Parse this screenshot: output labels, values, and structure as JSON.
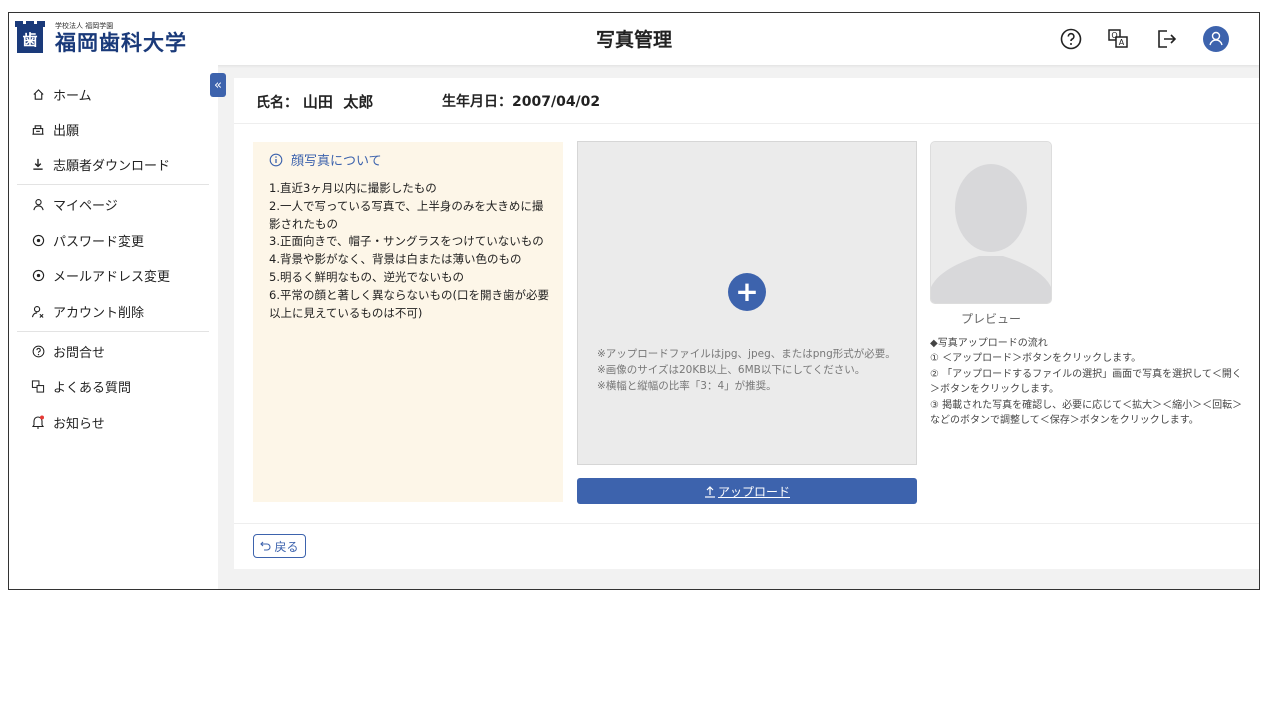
{
  "header": {
    "logo_sub": "学校法人 福岡学園",
    "logo_main": "福岡歯科大学",
    "title": "写真管理",
    "icons": [
      "help-icon",
      "faq-icon",
      "logout-icon",
      "user-avatar-icon"
    ]
  },
  "sidebar": {
    "items": [
      {
        "label": "ホーム",
        "icon": "home-icon"
      },
      {
        "label": "出願",
        "icon": "apply-icon"
      },
      {
        "label": "志願者ダウンロード",
        "icon": "download-icon"
      },
      {
        "label": "マイページ",
        "icon": "user-icon"
      },
      {
        "label": "パスワード変更",
        "icon": "password-icon"
      },
      {
        "label": "メールアドレス変更",
        "icon": "mail-icon"
      },
      {
        "label": "アカウント削除",
        "icon": "user-remove-icon"
      },
      {
        "label": "お問合せ",
        "icon": "question-icon"
      },
      {
        "label": "よくある質問",
        "icon": "faq-icon"
      },
      {
        "label": "お知らせ",
        "icon": "bell-icon"
      }
    ],
    "collapse_glyph": "«"
  },
  "student": {
    "name_label": "氏名：",
    "name": "山田  太郎",
    "dob_label": "生年月日：",
    "dob": "2007/04/02"
  },
  "notes": {
    "title": "顔写真について",
    "items": [
      "1.直近3ヶ月以内に撮影したもの",
      "2.一人で写っている写真で、上半身のみを大きめに撮影されたもの",
      "3.正面向きで、帽子・サングラスをつけていないもの",
      "4.背景や影がなく、背景は白または薄い色のもの",
      "5.明るく鮮明なもの、逆光でないもの",
      "6.平常の顔と著しく異ならないもの(口を開き歯が必要以上に見えているものは不可)"
    ]
  },
  "upload": {
    "notes": [
      "※アップロードファイルはjpg、jpeg、またはpng形式が必要。",
      "※画像のサイズは20KB以上、6MB以下にしてください。",
      "※横幅と縦幅の比率「3：4」が推奨。"
    ],
    "button_label": "アップロード"
  },
  "preview": {
    "label": "プレビュー",
    "flow": [
      "◆写真アップロードの流れ",
      "① ＜アップロード＞ボタンをクリックします。",
      "② 「アップロードするファイルの選択」画面で写真を選択して＜開く＞ボタンをクリックします。",
      "③ 掲載された写真を確認し、必要に応じて＜拡大＞＜縮小＞＜回転＞などのボタンで調整して＜保存＞ボタンをクリックします。"
    ]
  },
  "footer": {
    "back_label": "戻る"
  },
  "colors": {
    "accent": "#3d63ad",
    "notes_bg": "#fdf6e8",
    "upload_bg": "#ebebeb"
  }
}
